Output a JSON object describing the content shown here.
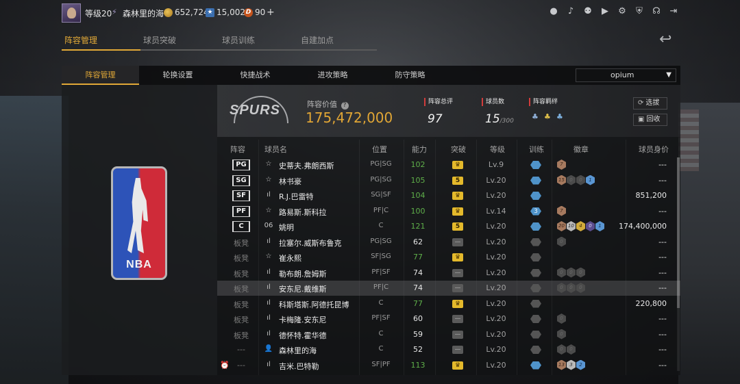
{
  "user": {
    "level": "等级20",
    "name": "森林里的海",
    "currency_gold": "652,724",
    "currency_star": "15,002",
    "currency_d": "90",
    "plus": "+"
  },
  "main_tabs": [
    "阵容管理",
    "球员突破",
    "球员训练",
    "自建加点"
  ],
  "sub_tabs": [
    "阵容管理",
    "轮换设置",
    "快捷战术",
    "进攻策略",
    "防守策略"
  ],
  "team_select": "opium",
  "team": {
    "value_label": "阵容价值",
    "value": "175,472,000",
    "total_label": "阵容总评",
    "total": "97",
    "count_label": "球员数",
    "count": "15",
    "count_max": "/300",
    "chem_label": "阵容羁绊",
    "btn_scout": "选拔",
    "btn_recycle": "回收"
  },
  "headers": {
    "lineup": "阵容",
    "name": "球员名",
    "position": "位置",
    "ability": "能力",
    "breakthrough": "突破",
    "level": "等级",
    "training": "训练",
    "badges": "徽章",
    "value": "球员身价"
  },
  "rows": [
    {
      "slot": "PG",
      "starter": true,
      "type": "☆",
      "name": "史蒂夫.弗朗西斯",
      "pos": "PG|SG",
      "ovr": "102",
      "ovr_green": true,
      "brk": "crown",
      "brk_val": "",
      "lv": "Lv.9",
      "train": "blue",
      "train_val": "",
      "badges": [
        [
          "bronze",
          "7"
        ]
      ],
      "value": "---"
    },
    {
      "slot": "SG",
      "starter": true,
      "type": "☆",
      "name": "林书豪",
      "pos": "PG|SG",
      "ovr": "105",
      "ovr_green": true,
      "brk": "num",
      "brk_val": "5",
      "lv": "Lv.20",
      "train": "blue",
      "train_val": "",
      "badges": [
        [
          "bronze",
          "15"
        ],
        [
          "empty",
          "0"
        ],
        [
          "empty",
          "0"
        ],
        [
          "blue",
          "1"
        ]
      ],
      "value": "---"
    },
    {
      "slot": "SF",
      "starter": true,
      "type": "ıl",
      "name": "R.J.巴雷特",
      "pos": "SG|SF",
      "ovr": "104",
      "ovr_green": true,
      "brk": "crown",
      "brk_val": "",
      "lv": "Lv.20",
      "train": "blue",
      "train_val": "",
      "badges": [],
      "value": "851,200"
    },
    {
      "slot": "PF",
      "starter": true,
      "type": "☆",
      "name": "路易斯.斯科拉",
      "pos": "PF|C",
      "ovr": "100",
      "ovr_green": true,
      "brk": "crown",
      "brk_val": "",
      "lv": "Lv.14",
      "train": "blue",
      "train_val": "3",
      "badges": [
        [
          "bronze",
          "7"
        ]
      ],
      "value": "---"
    },
    {
      "slot": "C",
      "starter": true,
      "type": "06",
      "name": "姚明",
      "pos": "C",
      "ovr": "121",
      "ovr_green": true,
      "brk": "num",
      "brk_val": "5",
      "lv": "Lv.20",
      "train": "blue",
      "train_val": "",
      "badges": [
        [
          "bronze",
          "20"
        ],
        [
          "silver",
          "10"
        ],
        [
          "gold",
          "4"
        ],
        [
          "purple",
          "0"
        ],
        [
          "blue",
          "1"
        ]
      ],
      "value": "174,400,000"
    },
    {
      "slot": "板凳",
      "starter": false,
      "type": "ıl",
      "name": "拉塞尔.威斯布鲁克",
      "pos": "PG|SG",
      "ovr": "62",
      "ovr_green": false,
      "brk": "none",
      "brk_val": "",
      "lv": "Lv.20",
      "train": "grey",
      "train_val": "",
      "badges": [
        [
          "empty",
          "0"
        ]
      ],
      "value": "---"
    },
    {
      "slot": "板凳",
      "starter": false,
      "type": "☆",
      "name": "崔永熙",
      "pos": "SF|SG",
      "ovr": "77",
      "ovr_green": true,
      "brk": "crown",
      "brk_val": "",
      "lv": "Lv.20",
      "train": "grey",
      "train_val": "",
      "badges": [],
      "value": "---"
    },
    {
      "slot": "板凳",
      "starter": false,
      "type": "ıl",
      "name": "勒布朗.詹姆斯",
      "pos": "PF|SF",
      "ovr": "74",
      "ovr_green": false,
      "brk": "none",
      "brk_val": "",
      "lv": "Lv.20",
      "train": "grey",
      "train_val": "",
      "badges": [
        [
          "empty",
          "0"
        ],
        [
          "empty",
          "0"
        ],
        [
          "empty",
          "0"
        ]
      ],
      "value": "---"
    },
    {
      "slot": "板凳",
      "starter": false,
      "type": "ıl",
      "name": "安东尼.戴维斯",
      "pos": "PF|C",
      "ovr": "74",
      "ovr_green": false,
      "brk": "none",
      "brk_val": "",
      "lv": "Lv.20",
      "train": "grey",
      "train_val": "",
      "badges": [
        [
          "empty",
          "0"
        ],
        [
          "empty",
          "0"
        ],
        [
          "empty",
          "0"
        ]
      ],
      "value": "---",
      "highlight": true
    },
    {
      "slot": "板凳",
      "starter": false,
      "type": "ıl",
      "name": "科斯塔斯.阿德托昆博",
      "pos": "C",
      "ovr": "77",
      "ovr_green": true,
      "brk": "crown",
      "brk_val": "",
      "lv": "Lv.20",
      "train": "grey",
      "train_val": "",
      "badges": [],
      "value": "220,800"
    },
    {
      "slot": "板凳",
      "starter": false,
      "type": "ıl",
      "name": "卡梅隆.安东尼",
      "pos": "PF|SF",
      "ovr": "60",
      "ovr_green": false,
      "brk": "none",
      "brk_val": "",
      "lv": "Lv.20",
      "train": "grey",
      "train_val": "",
      "badges": [
        [
          "empty",
          "0"
        ]
      ],
      "value": "---"
    },
    {
      "slot": "板凳",
      "starter": false,
      "type": "ıl",
      "name": "德怀特.霍华德",
      "pos": "C",
      "ovr": "59",
      "ovr_green": false,
      "brk": "none",
      "brk_val": "",
      "lv": "Lv.20",
      "train": "grey",
      "train_val": "",
      "badges": [
        [
          "empty",
          "0"
        ]
      ],
      "value": "---"
    },
    {
      "slot": "---",
      "starter": false,
      "type": "👤",
      "name": "森林里的海",
      "pos": "C",
      "ovr": "52",
      "ovr_green": false,
      "brk": "none",
      "brk_val": "",
      "lv": "Lv.20",
      "train": "grey",
      "train_val": "",
      "badges": [
        [
          "empty",
          "0"
        ],
        [
          "empty",
          "0"
        ]
      ],
      "value": "---"
    },
    {
      "slot": "---",
      "starter": false,
      "alarm": true,
      "type": "ıl",
      "name": "吉米.巴特勒",
      "pos": "SF|PF",
      "ovr": "113",
      "ovr_green": true,
      "brk": "crown",
      "brk_val": "",
      "lv": "Lv.20",
      "train": "blue",
      "train_val": "",
      "badges": [
        [
          "bronze",
          "13"
        ],
        [
          "silver",
          "3"
        ],
        [
          "blue",
          "2"
        ]
      ],
      "value": "---"
    }
  ],
  "colors": {
    "accent": "#e2a937",
    "green": "#5fb04a",
    "panel": "#121315"
  }
}
